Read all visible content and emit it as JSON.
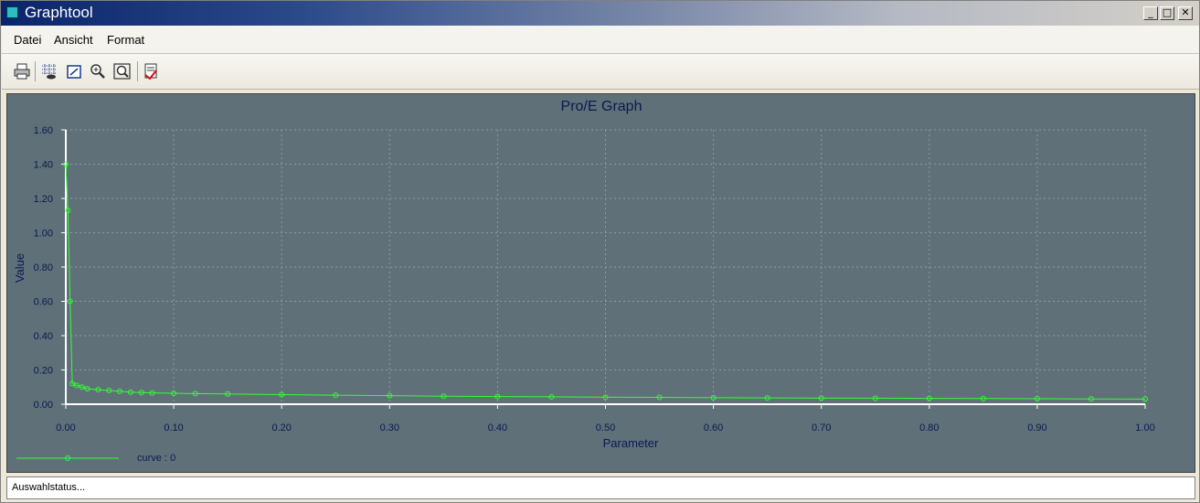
{
  "window": {
    "title": "Graphtool"
  },
  "menu": {
    "items": [
      "Datei",
      "Ansicht",
      "Format"
    ]
  },
  "toolbar": {
    "icons": [
      "printer-icon",
      "grid-icon",
      "fit-icon",
      "zoom-in-icon",
      "zoom-window-icon",
      "export-icon"
    ]
  },
  "statusbar": {
    "text": "Auswahlstatus..."
  },
  "colors": {
    "plot_bg": "#5f7079",
    "axis": "#ffffff",
    "curve": "#33ff33",
    "title": "#0a1a50",
    "grid": "#8a9aa3"
  },
  "chart_data": {
    "type": "line",
    "title": "Pro/E Graph",
    "xlabel": "Parameter",
    "ylabel": "Value",
    "xlim": [
      0,
      1
    ],
    "ylim": [
      0,
      1.6
    ],
    "x_ticks": [
      "0.00",
      "0.10",
      "0.20",
      "0.30",
      "0.40",
      "0.50",
      "0.60",
      "0.70",
      "0.80",
      "0.90",
      "1.00"
    ],
    "y_ticks": [
      "0.00",
      "0.20",
      "0.40",
      "0.60",
      "0.80",
      "1.00",
      "1.20",
      "1.40",
      "1.60"
    ],
    "grid": true,
    "legend_position": "bottom-left",
    "series": [
      {
        "name": "curve : 0",
        "x": [
          0.0,
          0.002,
          0.004,
          0.006,
          0.01,
          0.015,
          0.02,
          0.03,
          0.04,
          0.05,
          0.06,
          0.07,
          0.08,
          0.1,
          0.12,
          0.15,
          0.2,
          0.25,
          0.3,
          0.35,
          0.4,
          0.45,
          0.5,
          0.55,
          0.6,
          0.65,
          0.7,
          0.75,
          0.8,
          0.85,
          0.9,
          0.95,
          1.0
        ],
        "y": [
          1.4,
          1.13,
          0.6,
          0.12,
          0.11,
          0.1,
          0.09,
          0.085,
          0.08,
          0.075,
          0.07,
          0.068,
          0.066,
          0.064,
          0.062,
          0.06,
          0.056,
          0.053,
          0.05,
          0.047,
          0.045,
          0.043,
          0.041,
          0.04,
          0.038,
          0.037,
          0.036,
          0.035,
          0.034,
          0.033,
          0.032,
          0.031,
          0.03
        ]
      }
    ]
  }
}
